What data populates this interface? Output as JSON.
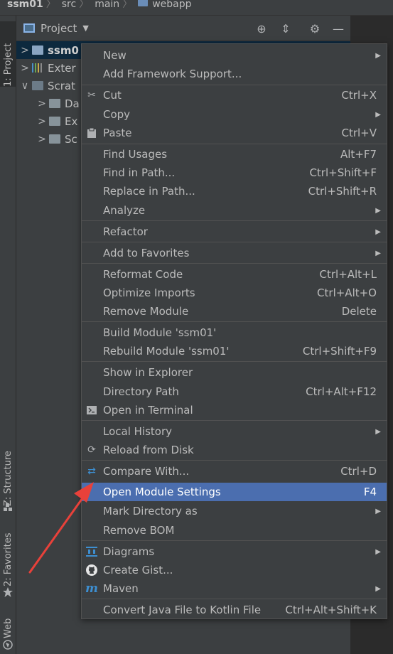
{
  "breadcrumb": {
    "items": [
      "ssm01",
      "src",
      "main",
      "webapp"
    ]
  },
  "tool_strip": {
    "project_tab": "1: Project",
    "structure_tab": "Z: Structure",
    "favorites_tab": "2: Favorites",
    "web_tab": "Web"
  },
  "project_panel": {
    "title": "Project",
    "tree": [
      {
        "label": "ssm0",
        "icon": "module-folder-icon",
        "selected": true
      },
      {
        "label": "Exter",
        "icon": "libraries-icon"
      },
      {
        "label": "Scrat",
        "icon": "scratches-icon"
      },
      {
        "label": "Da",
        "icon": "folder-icon"
      },
      {
        "label": "Ex",
        "icon": "folder-icon"
      },
      {
        "label": "Sc",
        "icon": "folder-icon"
      }
    ]
  },
  "context_menu": {
    "items": [
      {
        "label": "New",
        "submenu": true
      },
      {
        "label": "Add Framework Support..."
      },
      {
        "label": "Cut",
        "shortcut": "Ctrl+X",
        "icon": "scissors-icon"
      },
      {
        "label": "Copy",
        "submenu": true
      },
      {
        "label": "Paste",
        "shortcut": "Ctrl+V",
        "icon": "clipboard-icon"
      },
      {
        "label": "Find Usages",
        "shortcut": "Alt+F7"
      },
      {
        "label": "Find in Path...",
        "shortcut": "Ctrl+Shift+F"
      },
      {
        "label": "Replace in Path...",
        "shortcut": "Ctrl+Shift+R"
      },
      {
        "label": "Analyze",
        "submenu": true
      },
      {
        "label": "Refactor",
        "submenu": true
      },
      {
        "label": "Add to Favorites",
        "submenu": true
      },
      {
        "label": "Reformat Code",
        "shortcut": "Ctrl+Alt+L"
      },
      {
        "label": "Optimize Imports",
        "shortcut": "Ctrl+Alt+O"
      },
      {
        "label": "Remove Module",
        "shortcut": "Delete"
      },
      {
        "label": "Build Module 'ssm01'"
      },
      {
        "label": "Rebuild Module 'ssm01'",
        "shortcut": "Ctrl+Shift+F9"
      },
      {
        "label": "Show in Explorer"
      },
      {
        "label": "Directory Path",
        "shortcut": "Ctrl+Alt+F12"
      },
      {
        "label": "Open in Terminal",
        "icon": "terminal-icon"
      },
      {
        "label": "Local History",
        "submenu": true
      },
      {
        "label": "Reload from Disk",
        "icon": "reload-icon"
      },
      {
        "label": "Compare With...",
        "shortcut": "Ctrl+D",
        "icon": "compare-icon"
      },
      {
        "label": "Open Module Settings",
        "shortcut": "F4",
        "highlighted": true
      },
      {
        "label": "Mark Directory as",
        "submenu": true
      },
      {
        "label": "Remove BOM"
      },
      {
        "label": "Diagrams",
        "submenu": true,
        "icon": "diagram-icon"
      },
      {
        "label": "Create Gist...",
        "icon": "github-icon"
      },
      {
        "label": "Maven",
        "submenu": true,
        "icon": "maven-icon"
      },
      {
        "label": "Convert Java File to Kotlin File",
        "shortcut": "Ctrl+Alt+Shift+K"
      }
    ]
  },
  "colors": {
    "menu_bg": "#3c3f41",
    "highlight": "#4b6eaf",
    "annotation_arrow": "#e8413a"
  }
}
